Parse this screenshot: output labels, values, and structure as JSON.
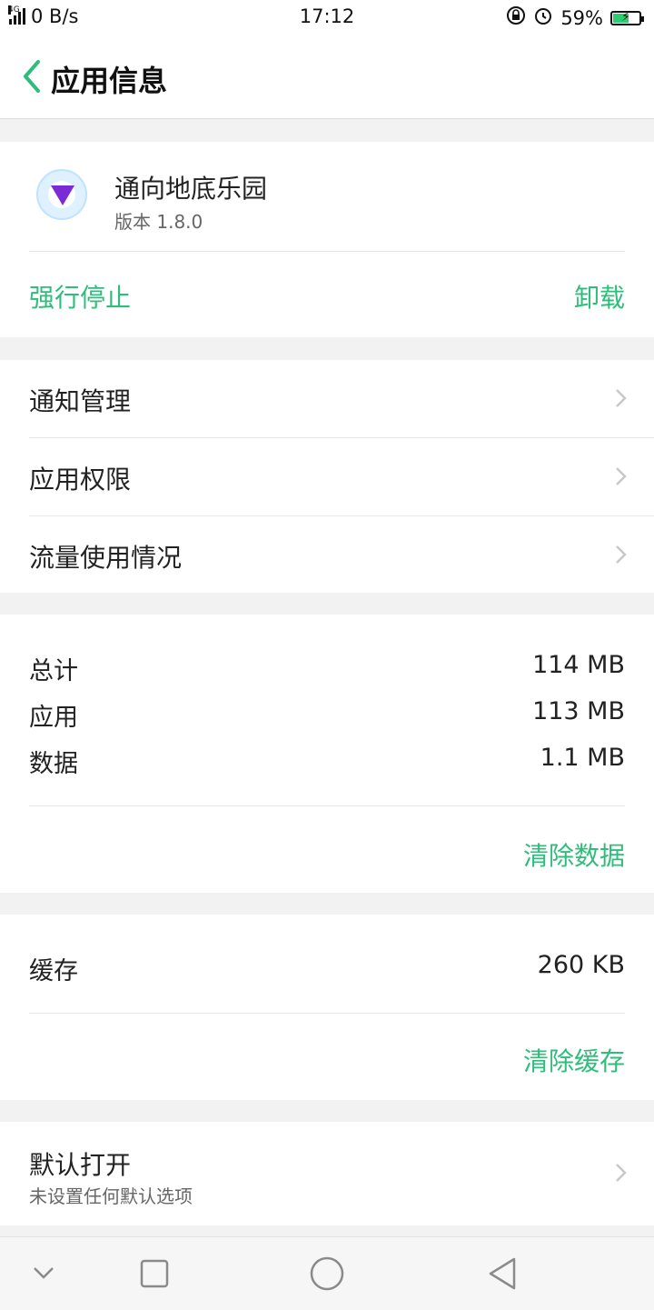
{
  "status_bar": {
    "network_type": "4G",
    "speed": "0 B/s",
    "time": "17:12",
    "battery_percent": "59%",
    "battery_level": 0.59,
    "icons": [
      "signal-icon",
      "orientation-lock-icon",
      "alarm-icon",
      "battery-charging-icon"
    ]
  },
  "header": {
    "title": "应用信息",
    "back_icon": "chevron-left-icon"
  },
  "app": {
    "name": "通向地底乐园",
    "version": "版本 1.8.0",
    "force_stop": "强行停止",
    "uninstall": "卸载"
  },
  "settings": {
    "items": [
      {
        "label": "通知管理"
      },
      {
        "label": "应用权限"
      },
      {
        "label": "流量使用情况"
      }
    ]
  },
  "storage": {
    "rows": [
      {
        "key": "总计",
        "value": "114 MB"
      },
      {
        "key": "应用",
        "value": "113 MB"
      },
      {
        "key": "数据",
        "value": "1.1 MB"
      }
    ],
    "clear_data": "清除数据"
  },
  "cache": {
    "key": "缓存",
    "value": "260 KB",
    "clear_cache": "清除缓存"
  },
  "default_open": {
    "title": "默认打开",
    "subtitle": "未设置任何默认选项"
  },
  "nav": {
    "icons": [
      "chevron-down-icon",
      "square-icon",
      "circle-icon",
      "triangle-back-icon"
    ]
  },
  "colors": {
    "accent": "#2ebd7a",
    "background": "#f2f2f2"
  }
}
